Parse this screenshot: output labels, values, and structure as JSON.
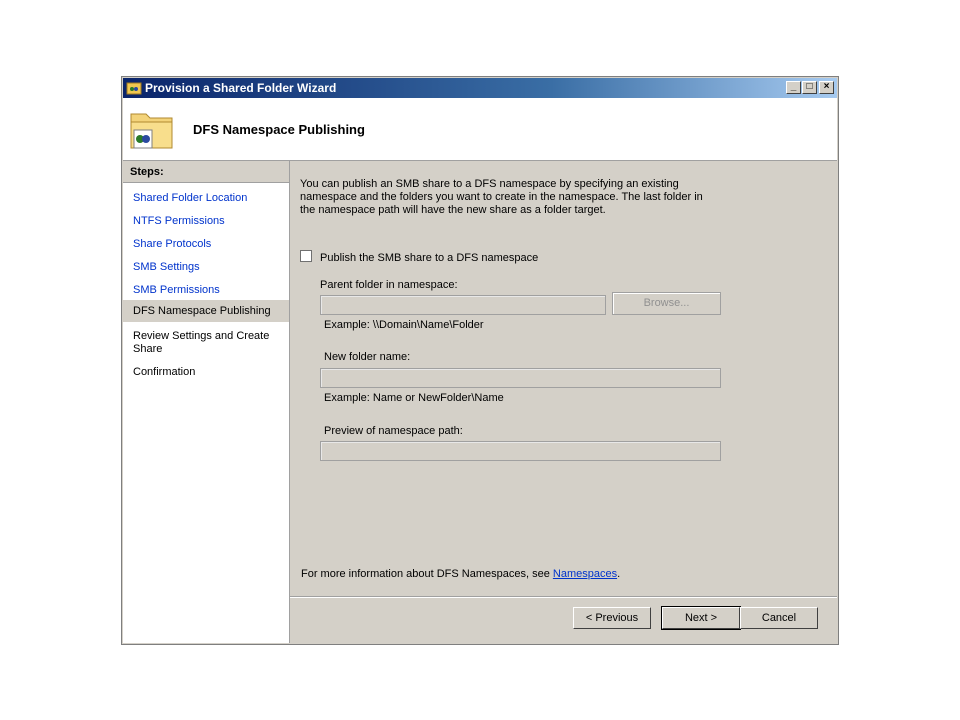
{
  "window": {
    "title": "Provision a Shared Folder Wizard",
    "controls": {
      "minimize": "_",
      "maximize": "□",
      "close": "×"
    }
  },
  "header": {
    "title": "DFS Namespace Publishing"
  },
  "steps": {
    "title": "Steps:",
    "items": [
      {
        "label": "Shared Folder Location"
      },
      {
        "label": "NTFS Permissions"
      },
      {
        "label": "Share Protocols"
      },
      {
        "label": "SMB Settings"
      },
      {
        "label": "SMB Permissions"
      },
      {
        "label": "DFS Namespace Publishing"
      },
      {
        "label": "Review Settings and Create Share"
      },
      {
        "label": "Confirmation"
      }
    ]
  },
  "main": {
    "description": "You can publish an SMB share to a DFS namespace by specifying an existing namespace and the folders you want to create in the namespace. The last folder in the namespace path will have the new share as a folder target.",
    "publish_checkbox": {
      "label": "Publish the SMB share to a DFS namespace",
      "checked": false
    },
    "parent_folder": {
      "label": "Parent folder in namespace:",
      "value": "",
      "example": "Example: \\\\Domain\\Name\\Folder"
    },
    "browse_label": "Browse...",
    "new_folder": {
      "label": "New folder name:",
      "value": "",
      "example": "Example: Name or NewFolder\\Name"
    },
    "preview": {
      "label": "Preview of namespace path:",
      "value": ""
    },
    "more_info_text": "For more information about DFS Namespaces, see ",
    "more_info_link": "Namespaces",
    "more_info_suffix": "."
  },
  "footer": {
    "previous_label": "< Previous",
    "next_label": "Next >",
    "cancel_label": "Cancel"
  }
}
